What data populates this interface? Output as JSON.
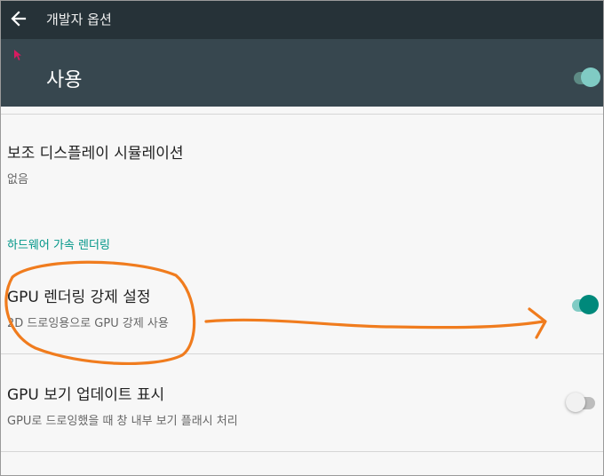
{
  "appbar": {
    "title": "개발자 옵션"
  },
  "master_switch": {
    "label": "사용",
    "checked": true
  },
  "preferences": [
    {
      "title": "보조 디스플레이 시뮬레이션",
      "summary": "없음"
    },
    {
      "title": "GPU 렌더링 강제 설정",
      "summary": "2D 드로잉용으로 GPU 강제 사용",
      "checked": true
    },
    {
      "title": "GPU 보기 업데이트 표시",
      "summary": "GPU로 드로잉했을 때 창 내부 보기 플래시 처리",
      "checked": false
    }
  ],
  "category": {
    "label": "하드웨어 가속 렌더링"
  },
  "colors": {
    "accent": "#009688",
    "appbar": "#263238",
    "master_bar": "#37474f",
    "annotation": "#f07c1e"
  },
  "icons": {
    "back": "arrow-left-icon",
    "cursor": "mouse-pointer-icon"
  }
}
